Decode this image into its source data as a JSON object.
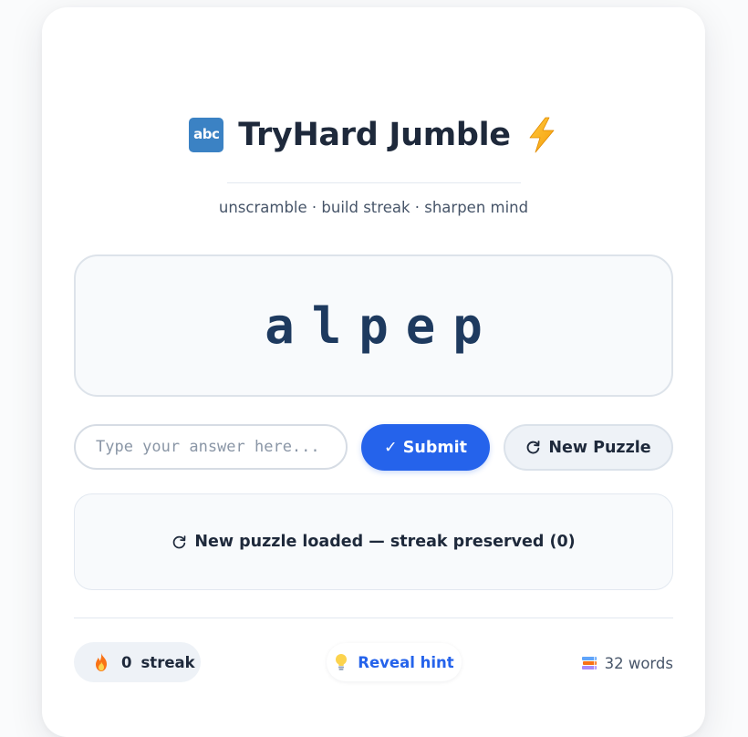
{
  "app": {
    "title": "TryHard Jumble",
    "title_icon_text": "abc",
    "subtitle": "unscramble · build streak · sharpen mind"
  },
  "puzzle": {
    "scrambled_word": "alpep"
  },
  "controls": {
    "answer_placeholder": "Type your answer here...",
    "answer_value": "",
    "submit_label": "✓ Submit",
    "new_puzzle_label": "New Puzzle"
  },
  "status": {
    "message": "New puzzle loaded — streak preserved (0)"
  },
  "footer": {
    "streak_count": "0",
    "streak_label": "streak",
    "hint_label": "Reveal hint",
    "words_count": "32 words"
  },
  "icons": {
    "title_left": "abc-icon",
    "title_right": "lightning-bolt-icon",
    "new_puzzle": "refresh-icon",
    "status": "refresh-icon",
    "streak": "fire-icon",
    "hint": "lightbulb-icon",
    "words": "books-icon"
  },
  "colors": {
    "accent": "#2563eb",
    "title_icon_bg": "#3b82c4",
    "bolt": "#f5a623",
    "scrambled_text": "#1e3a5f"
  }
}
